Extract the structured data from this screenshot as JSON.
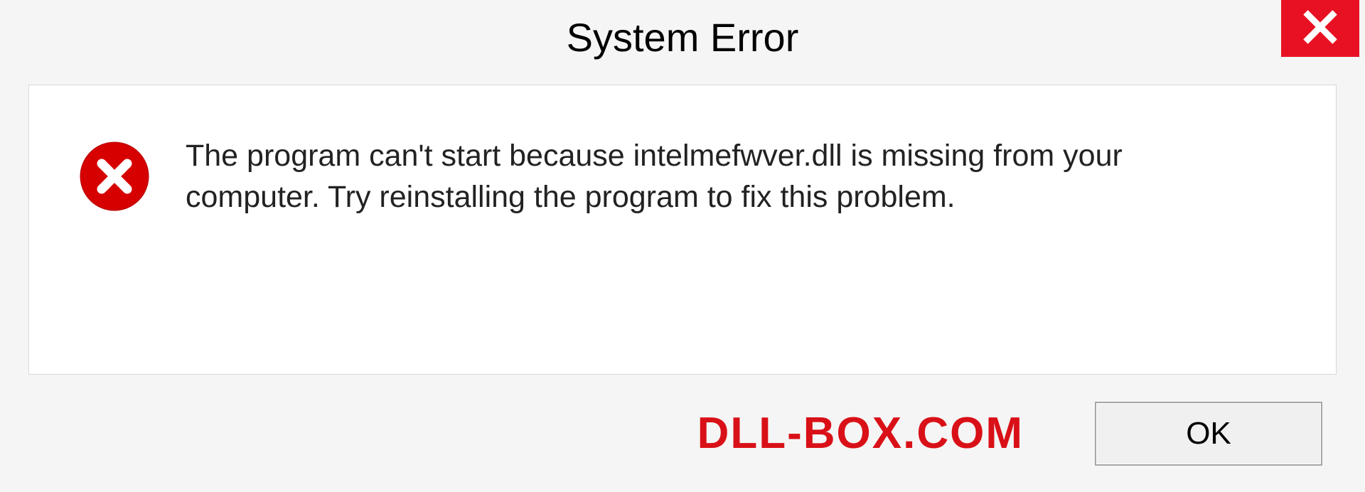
{
  "dialog": {
    "title": "System Error",
    "message": "The program can't start because intelmefwver.dll is missing from your computer. Try reinstalling the program to fix this problem.",
    "watermark": "DLL-BOX.COM",
    "ok_label": "OK"
  }
}
